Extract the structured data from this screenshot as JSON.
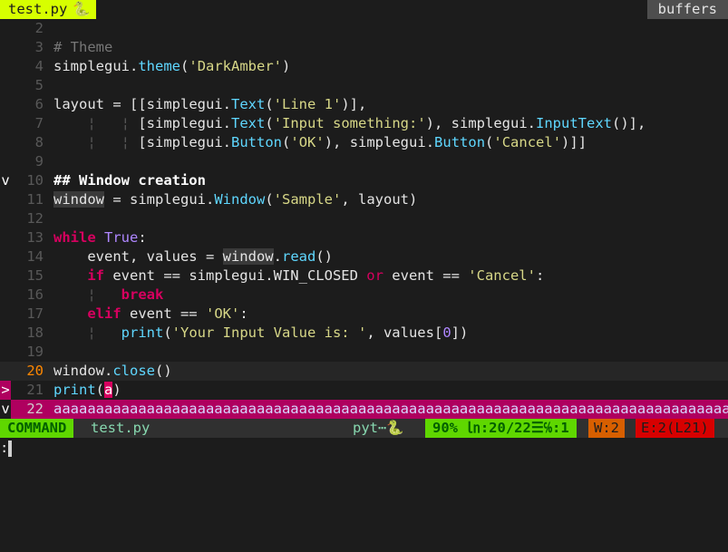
{
  "tabline": {
    "active_tab": "test.py",
    "active_icon": "🐍",
    "buffers_label": "buffers"
  },
  "lines": [
    {
      "n": "2",
      "sign": "",
      "tokens": []
    },
    {
      "n": "3",
      "sign": "",
      "tokens": [
        {
          "c": "comment",
          "t": "# Theme"
        }
      ]
    },
    {
      "n": "4",
      "sign": "",
      "tokens": [
        {
          "c": "ident",
          "t": "simplegui"
        },
        {
          "c": "op",
          "t": "."
        },
        {
          "c": "func",
          "t": "theme"
        },
        {
          "c": "op",
          "t": "("
        },
        {
          "c": "str",
          "t": "'DarkAmber'"
        },
        {
          "c": "op",
          "t": ")"
        }
      ]
    },
    {
      "n": "5",
      "sign": "",
      "tokens": []
    },
    {
      "n": "6",
      "sign": "",
      "tokens": [
        {
          "c": "ident",
          "t": "layout "
        },
        {
          "c": "op",
          "t": "= [["
        },
        {
          "c": "ident",
          "t": "simplegui"
        },
        {
          "c": "op",
          "t": "."
        },
        {
          "c": "func",
          "t": "Text"
        },
        {
          "c": "op",
          "t": "("
        },
        {
          "c": "str",
          "t": "'Line 1'"
        },
        {
          "c": "op",
          "t": ")],"
        }
      ]
    },
    {
      "n": "7",
      "sign": "",
      "tokens": [
        {
          "c": "indent",
          "t": "    ¦   ¦ "
        },
        {
          "c": "op",
          "t": "["
        },
        {
          "c": "ident",
          "t": "simplegui"
        },
        {
          "c": "op",
          "t": "."
        },
        {
          "c": "func",
          "t": "Text"
        },
        {
          "c": "op",
          "t": "("
        },
        {
          "c": "str",
          "t": "'Input something:'"
        },
        {
          "c": "op",
          "t": "), "
        },
        {
          "c": "ident",
          "t": "simplegui"
        },
        {
          "c": "op",
          "t": "."
        },
        {
          "c": "func",
          "t": "InputText"
        },
        {
          "c": "op",
          "t": "()],"
        }
      ]
    },
    {
      "n": "8",
      "sign": "",
      "tokens": [
        {
          "c": "indent",
          "t": "    ¦   ¦ "
        },
        {
          "c": "op",
          "t": "["
        },
        {
          "c": "ident",
          "t": "simplegui"
        },
        {
          "c": "op",
          "t": "."
        },
        {
          "c": "func",
          "t": "Button"
        },
        {
          "c": "op",
          "t": "("
        },
        {
          "c": "str",
          "t": "'OK'"
        },
        {
          "c": "op",
          "t": "), "
        },
        {
          "c": "ident",
          "t": "simplegui"
        },
        {
          "c": "op",
          "t": "."
        },
        {
          "c": "func",
          "t": "Button"
        },
        {
          "c": "op",
          "t": "("
        },
        {
          "c": "str",
          "t": "'Cancel'"
        },
        {
          "c": "op",
          "t": ")]]"
        }
      ]
    },
    {
      "n": "9",
      "sign": "",
      "tokens": []
    },
    {
      "n": "10",
      "sign": "v",
      "tokens": [
        {
          "c": "heading",
          "t": "## Window creation"
        }
      ]
    },
    {
      "n": "11",
      "sign": "",
      "tokens": [
        {
          "c": "ident hl",
          "t": "window"
        },
        {
          "c": "ident",
          "t": " = simplegui"
        },
        {
          "c": "op",
          "t": "."
        },
        {
          "c": "func",
          "t": "Window"
        },
        {
          "c": "op",
          "t": "("
        },
        {
          "c": "str",
          "t": "'Sample'"
        },
        {
          "c": "op",
          "t": ", layout)"
        }
      ]
    },
    {
      "n": "12",
      "sign": "",
      "tokens": []
    },
    {
      "n": "13",
      "sign": "",
      "tokens": [
        {
          "c": "kwb",
          "t": "while"
        },
        {
          "c": "op",
          "t": " "
        },
        {
          "c": "const",
          "t": "True"
        },
        {
          "c": "op",
          "t": ":"
        }
      ]
    },
    {
      "n": "14",
      "sign": "",
      "tokens": [
        {
          "c": "ident",
          "t": "    event, values = "
        },
        {
          "c": "ident hl",
          "t": "window"
        },
        {
          "c": "op",
          "t": "."
        },
        {
          "c": "func",
          "t": "read"
        },
        {
          "c": "op",
          "t": "()"
        }
      ]
    },
    {
      "n": "15",
      "sign": "",
      "tokens": [
        {
          "c": "op",
          "t": "    "
        },
        {
          "c": "kwb",
          "t": "if"
        },
        {
          "c": "ident",
          "t": " event == simplegui.WIN_CLOSED "
        },
        {
          "c": "kw",
          "t": "or"
        },
        {
          "c": "ident",
          "t": " event == "
        },
        {
          "c": "str",
          "t": "'Cancel'"
        },
        {
          "c": "op",
          "t": ":"
        }
      ]
    },
    {
      "n": "16",
      "sign": "",
      "tokens": [
        {
          "c": "indent",
          "t": "    ¦   "
        },
        {
          "c": "kwb",
          "t": "break"
        }
      ]
    },
    {
      "n": "17",
      "sign": "",
      "tokens": [
        {
          "c": "op",
          "t": "    "
        },
        {
          "c": "kwb",
          "t": "elif"
        },
        {
          "c": "ident",
          "t": " event == "
        },
        {
          "c": "str",
          "t": "'OK'"
        },
        {
          "c": "op",
          "t": ":"
        }
      ]
    },
    {
      "n": "18",
      "sign": "",
      "tokens": [
        {
          "c": "indent",
          "t": "    ¦   "
        },
        {
          "c": "func",
          "t": "print"
        },
        {
          "c": "op",
          "t": "("
        },
        {
          "c": "str",
          "t": "'Your Input Value is: '"
        },
        {
          "c": "op",
          "t": ", values["
        },
        {
          "c": "num",
          "t": "0"
        },
        {
          "c": "op",
          "t": "])"
        }
      ]
    },
    {
      "n": "19",
      "sign": "",
      "tokens": []
    },
    {
      "n": "20",
      "sign": "",
      "cursor": true,
      "tokens": [
        {
          "c": "ident",
          "t": "window"
        },
        {
          "c": "op",
          "t": "."
        },
        {
          "c": "func",
          "t": "close"
        },
        {
          "c": "op",
          "t": "()"
        }
      ]
    },
    {
      "n": "21",
      "sign": ">",
      "tokens": [
        {
          "c": "func",
          "t": "print"
        },
        {
          "c": "op",
          "t": "("
        },
        {
          "c": "hl-cur",
          "t": "a"
        },
        {
          "c": "op",
          "t": ")"
        }
      ]
    },
    {
      "n": "22",
      "sign": "v",
      "overflow": true,
      "tokens": [
        {
          "c": "",
          "t": "aaaaaaaaaaaaaaaaaaaaaaaaaaaaaaaaaaaaaaaaaaaaaaaaaaaaaaaaaaaaaaaaaaaaaaaaaaaaaaaaaaaa"
        }
      ]
    }
  ],
  "statusline": {
    "mode": "COMMAND",
    "filename": "test.py",
    "filetype": "pyt⋯🐍",
    "position": "90% ㏑:20/22☰℅:1",
    "warnings": "W:2",
    "errors": "E:2(L21)"
  },
  "cmdline": {
    "text": ":"
  }
}
